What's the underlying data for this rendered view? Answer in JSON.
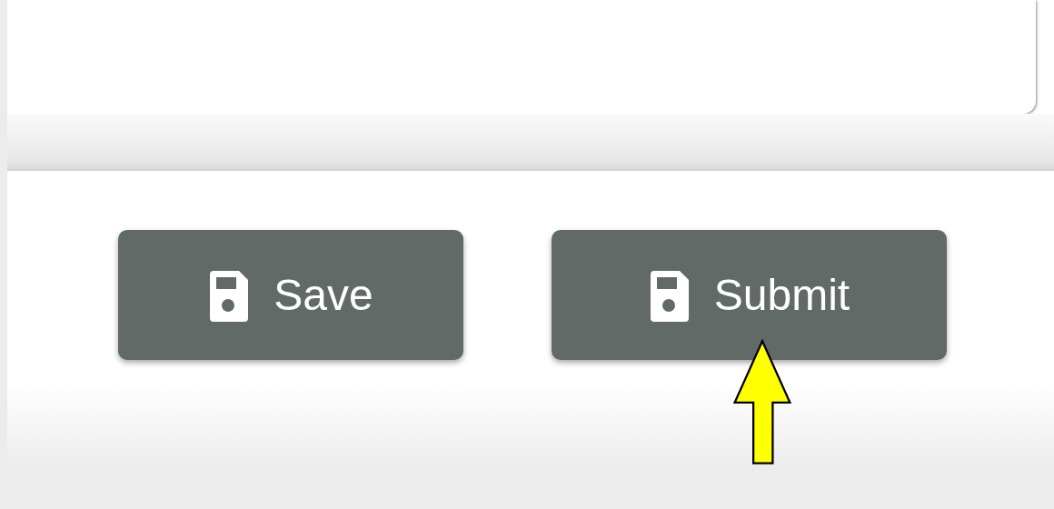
{
  "buttons": [
    {
      "label": "Save",
      "kind": "save"
    },
    {
      "label": "Submit",
      "kind": "save"
    }
  ]
}
